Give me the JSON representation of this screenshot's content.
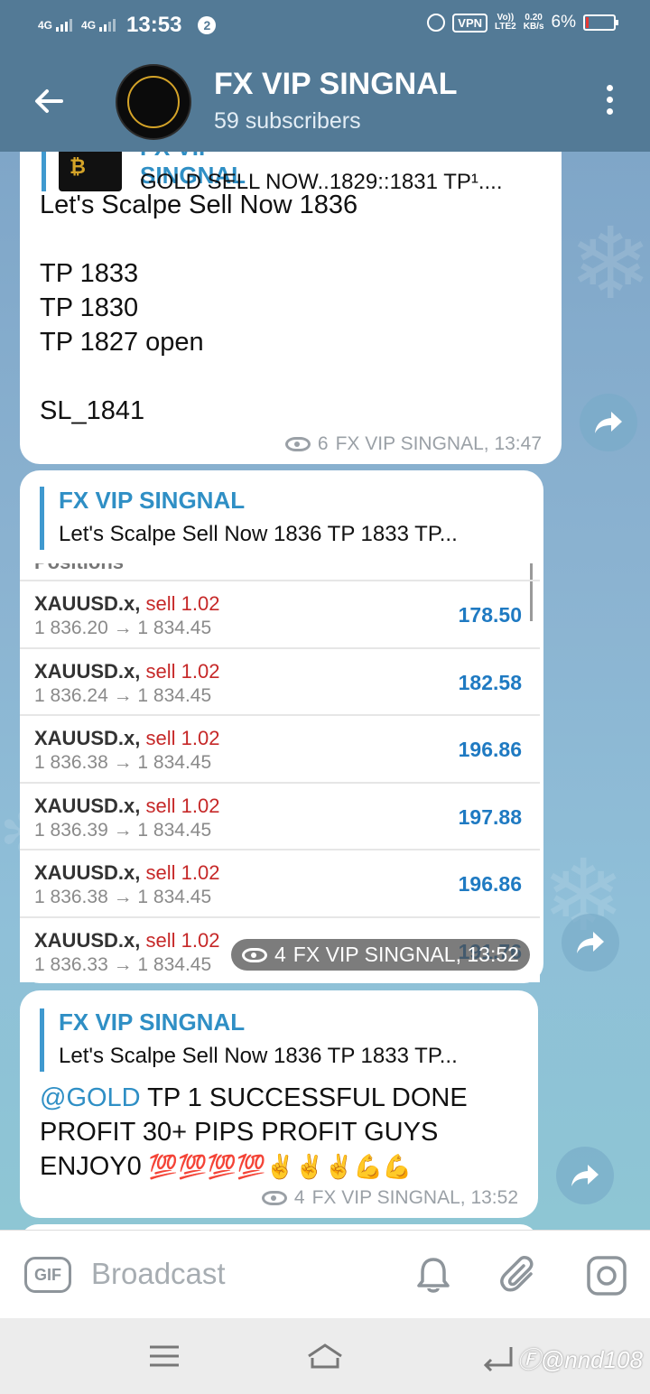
{
  "status_bar": {
    "net1": "4G",
    "net2": "4G",
    "time": "13:53",
    "notification_count": "2",
    "vpn": "VPN",
    "volte_top": "Vo))",
    "volte_bottom": "LTE2",
    "speed_top": "0.20",
    "speed_bottom": "KB/s",
    "battery": "6%"
  },
  "header": {
    "title": "FX VIP SINGNAL",
    "subtitle": "59 subscribers",
    "back_icon": "arrow-left-icon",
    "menu_icon": "more-vertical-icon"
  },
  "messages": [
    {
      "reply_name": "FX VIP SINGNAL",
      "reply_text": "GOLD SELL NOW..1829::1831  TP¹....",
      "text": "Let's Scalpe Sell Now 1836\n\nTP 1833\nTP 1830\nTP 1827 open\n\nSL_1841",
      "views": "6",
      "author_time": "FX VIP SINGNAL, 13:47"
    },
    {
      "reply_name": "FX VIP SINGNAL",
      "reply_text": "Let's Scalpe Sell Now 1836  TP 1833 TP...",
      "image_header": "Positions",
      "positions": [
        {
          "symbol": "XAUUSD.x,",
          "side": "sell 1.02",
          "prices": "1 836.20 → 1 834.45",
          "profit": "178.50"
        },
        {
          "symbol": "XAUUSD.x,",
          "side": "sell 1.02",
          "prices": "1 836.24 → 1 834.45",
          "profit": "182.58"
        },
        {
          "symbol": "XAUUSD.x,",
          "side": "sell 1.02",
          "prices": "1 836.38 → 1 834.45",
          "profit": "196.86"
        },
        {
          "symbol": "XAUUSD.x,",
          "side": "sell 1.02",
          "prices": "1 836.39 → 1 834.45",
          "profit": "197.88"
        },
        {
          "symbol": "XAUUSD.x,",
          "side": "sell 1.02",
          "prices": "1 836.38 → 1 834.45",
          "profit": "196.86"
        },
        {
          "symbol": "XAUUSD.x,",
          "side": "sell 1.02",
          "prices": "1 836.33 → 1 834.45",
          "profit": "191.76"
        }
      ],
      "views": "4",
      "author_time": "FX VIP SINGNAL, 13:52"
    },
    {
      "reply_name": "FX VIP SINGNAL",
      "reply_text": "Let's Scalpe Sell Now 1836  TP 1833 TP...",
      "mention": "@GOLD",
      "text": " TP 1 SUCCESSFUL DONE PROFIT 30+ PIPS PROFIT GUYS ENJOY0 ",
      "emojis": "💯💯💯💯✌️✌️✌️💪💪",
      "views": "4",
      "author_time": "FX VIP SINGNAL, 13:52"
    }
  ],
  "input_bar": {
    "gif_label": "GIF",
    "placeholder": "Broadcast"
  },
  "watermark": "Ⓕ@nnd108",
  "colors": {
    "header_bg": "#537a96",
    "accent": "#2f8fc5",
    "sell": "#c62828",
    "profit": "#1f7ac2"
  }
}
